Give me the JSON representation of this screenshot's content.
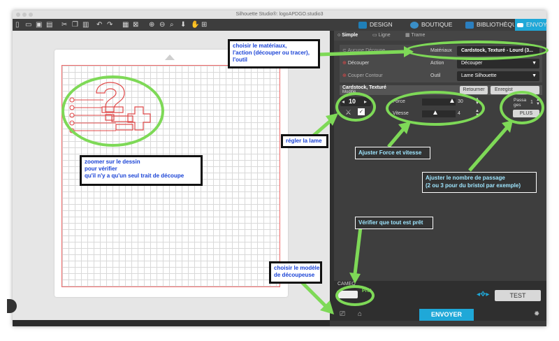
{
  "window": {
    "title": "Silhouette Studio®: logoAPDGO.studio3"
  },
  "nav": {
    "design": "DESIGN",
    "boutique": "BOUTIQUE",
    "bibliotheque": "BIBLIOTHÈQU",
    "envoyer": "ENVOYER"
  },
  "panel": {
    "tabs": {
      "simple": "Simple",
      "ligne": "Ligne",
      "trame": "Trame"
    },
    "rows": [
      {
        "left_label": "Aucune Découpe",
        "label": "Matériaux",
        "value": "Cardstock, Texturé - Lourd (3..."
      },
      {
        "left_label": "Découper",
        "label": "Action",
        "value": "Découper"
      },
      {
        "left_label": "Couper Contour",
        "label": "Outil",
        "value": "Lame Silhouette"
      }
    ],
    "profile_text": "Cardstock, Texturé",
    "profile_modified": "Modifié",
    "retourner": "Retourner",
    "enregistrer": "Enregist",
    "blade_value": "10",
    "force_label": "Force",
    "force_value": "30",
    "vitesse_label": "Vitesse",
    "vitesse_value": "4",
    "passages_label": "Passa\nges",
    "passages_value": "1",
    "plus": "PLUS"
  },
  "status": {
    "device": "CAMEO",
    "ready": "Prêt",
    "test": "TEST",
    "send": "ENVOYER"
  },
  "annotations": {
    "materiaux": "choisir le matériaux,\nl'action (découper ou tracer),\nl'outil",
    "zoom": "zoomer sur le dessin\npour vérifier\nqu'il n'y a qu'un seul trait de découpe",
    "lame": "régler la lame",
    "force": "Ajuster Force et vitesse",
    "passage": "Ajuster le nombre de passage\n(2 ou 3 pour du bristol par exemple)",
    "pret": "Vérifier que tout est prêt",
    "modele": "choisir le modèle\nde découpeuse"
  },
  "colors": {
    "accent": "#1fa8d8",
    "annotation_green": "#7ed957",
    "cut_line": "#ef6a6a"
  }
}
